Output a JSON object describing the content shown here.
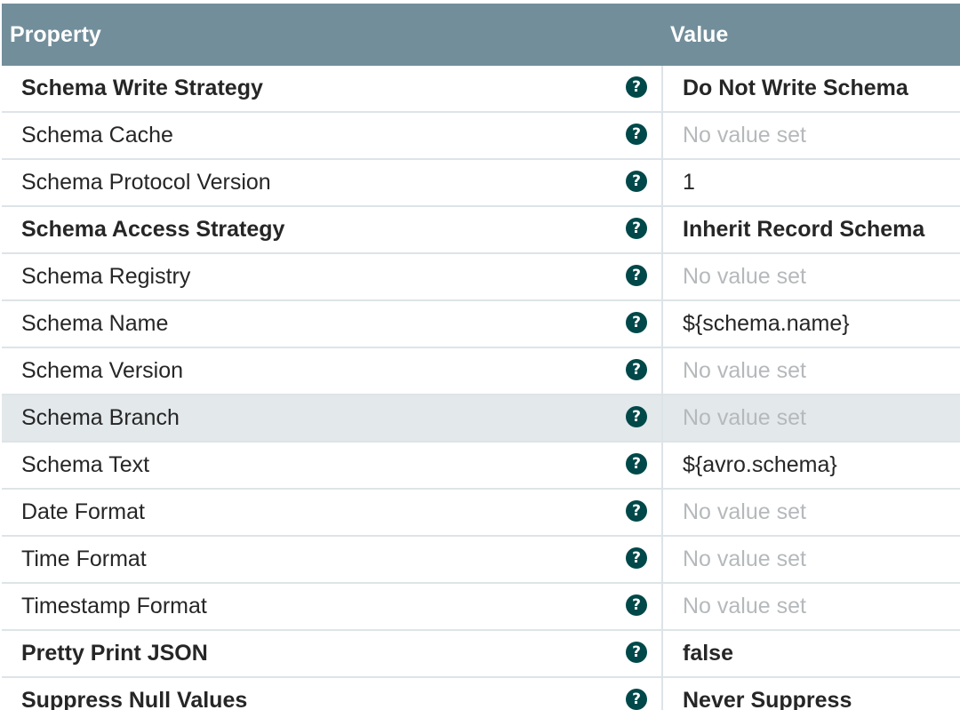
{
  "header": {
    "property_label": "Property",
    "value_label": "Value"
  },
  "help_icon_glyph": "?",
  "rows": [
    {
      "property": "Schema Write Strategy",
      "value": "Do Not Write Schema",
      "required": true,
      "empty": false
    },
    {
      "property": "Schema Cache",
      "value": "No value set",
      "required": false,
      "empty": true
    },
    {
      "property": "Schema Protocol Version",
      "value": "1",
      "required": false,
      "empty": false
    },
    {
      "property": "Schema Access Strategy",
      "value": "Inherit Record Schema",
      "required": true,
      "empty": false
    },
    {
      "property": "Schema Registry",
      "value": "No value set",
      "required": false,
      "empty": true
    },
    {
      "property": "Schema Name",
      "value": "${schema.name}",
      "required": false,
      "empty": false
    },
    {
      "property": "Schema Version",
      "value": "No value set",
      "required": false,
      "empty": true
    },
    {
      "property": "Schema Branch",
      "value": "No value set",
      "required": false,
      "empty": true,
      "hover": true
    },
    {
      "property": "Schema Text",
      "value": "${avro.schema}",
      "required": false,
      "empty": false
    },
    {
      "property": "Date Format",
      "value": "No value set",
      "required": false,
      "empty": true
    },
    {
      "property": "Time Format",
      "value": "No value set",
      "required": false,
      "empty": true
    },
    {
      "property": "Timestamp Format",
      "value": "No value set",
      "required": false,
      "empty": true
    },
    {
      "property": "Pretty Print JSON",
      "value": "false",
      "required": true,
      "empty": false
    },
    {
      "property": "Suppress Null Values",
      "value": "Never Suppress",
      "required": true,
      "empty": false
    }
  ],
  "colors": {
    "header_bg": "#728e9b",
    "help_icon": "#004849",
    "row_border": "#dde4e8",
    "hover_row": "#e3e8eb",
    "empty_value": "#b5b9bb"
  }
}
